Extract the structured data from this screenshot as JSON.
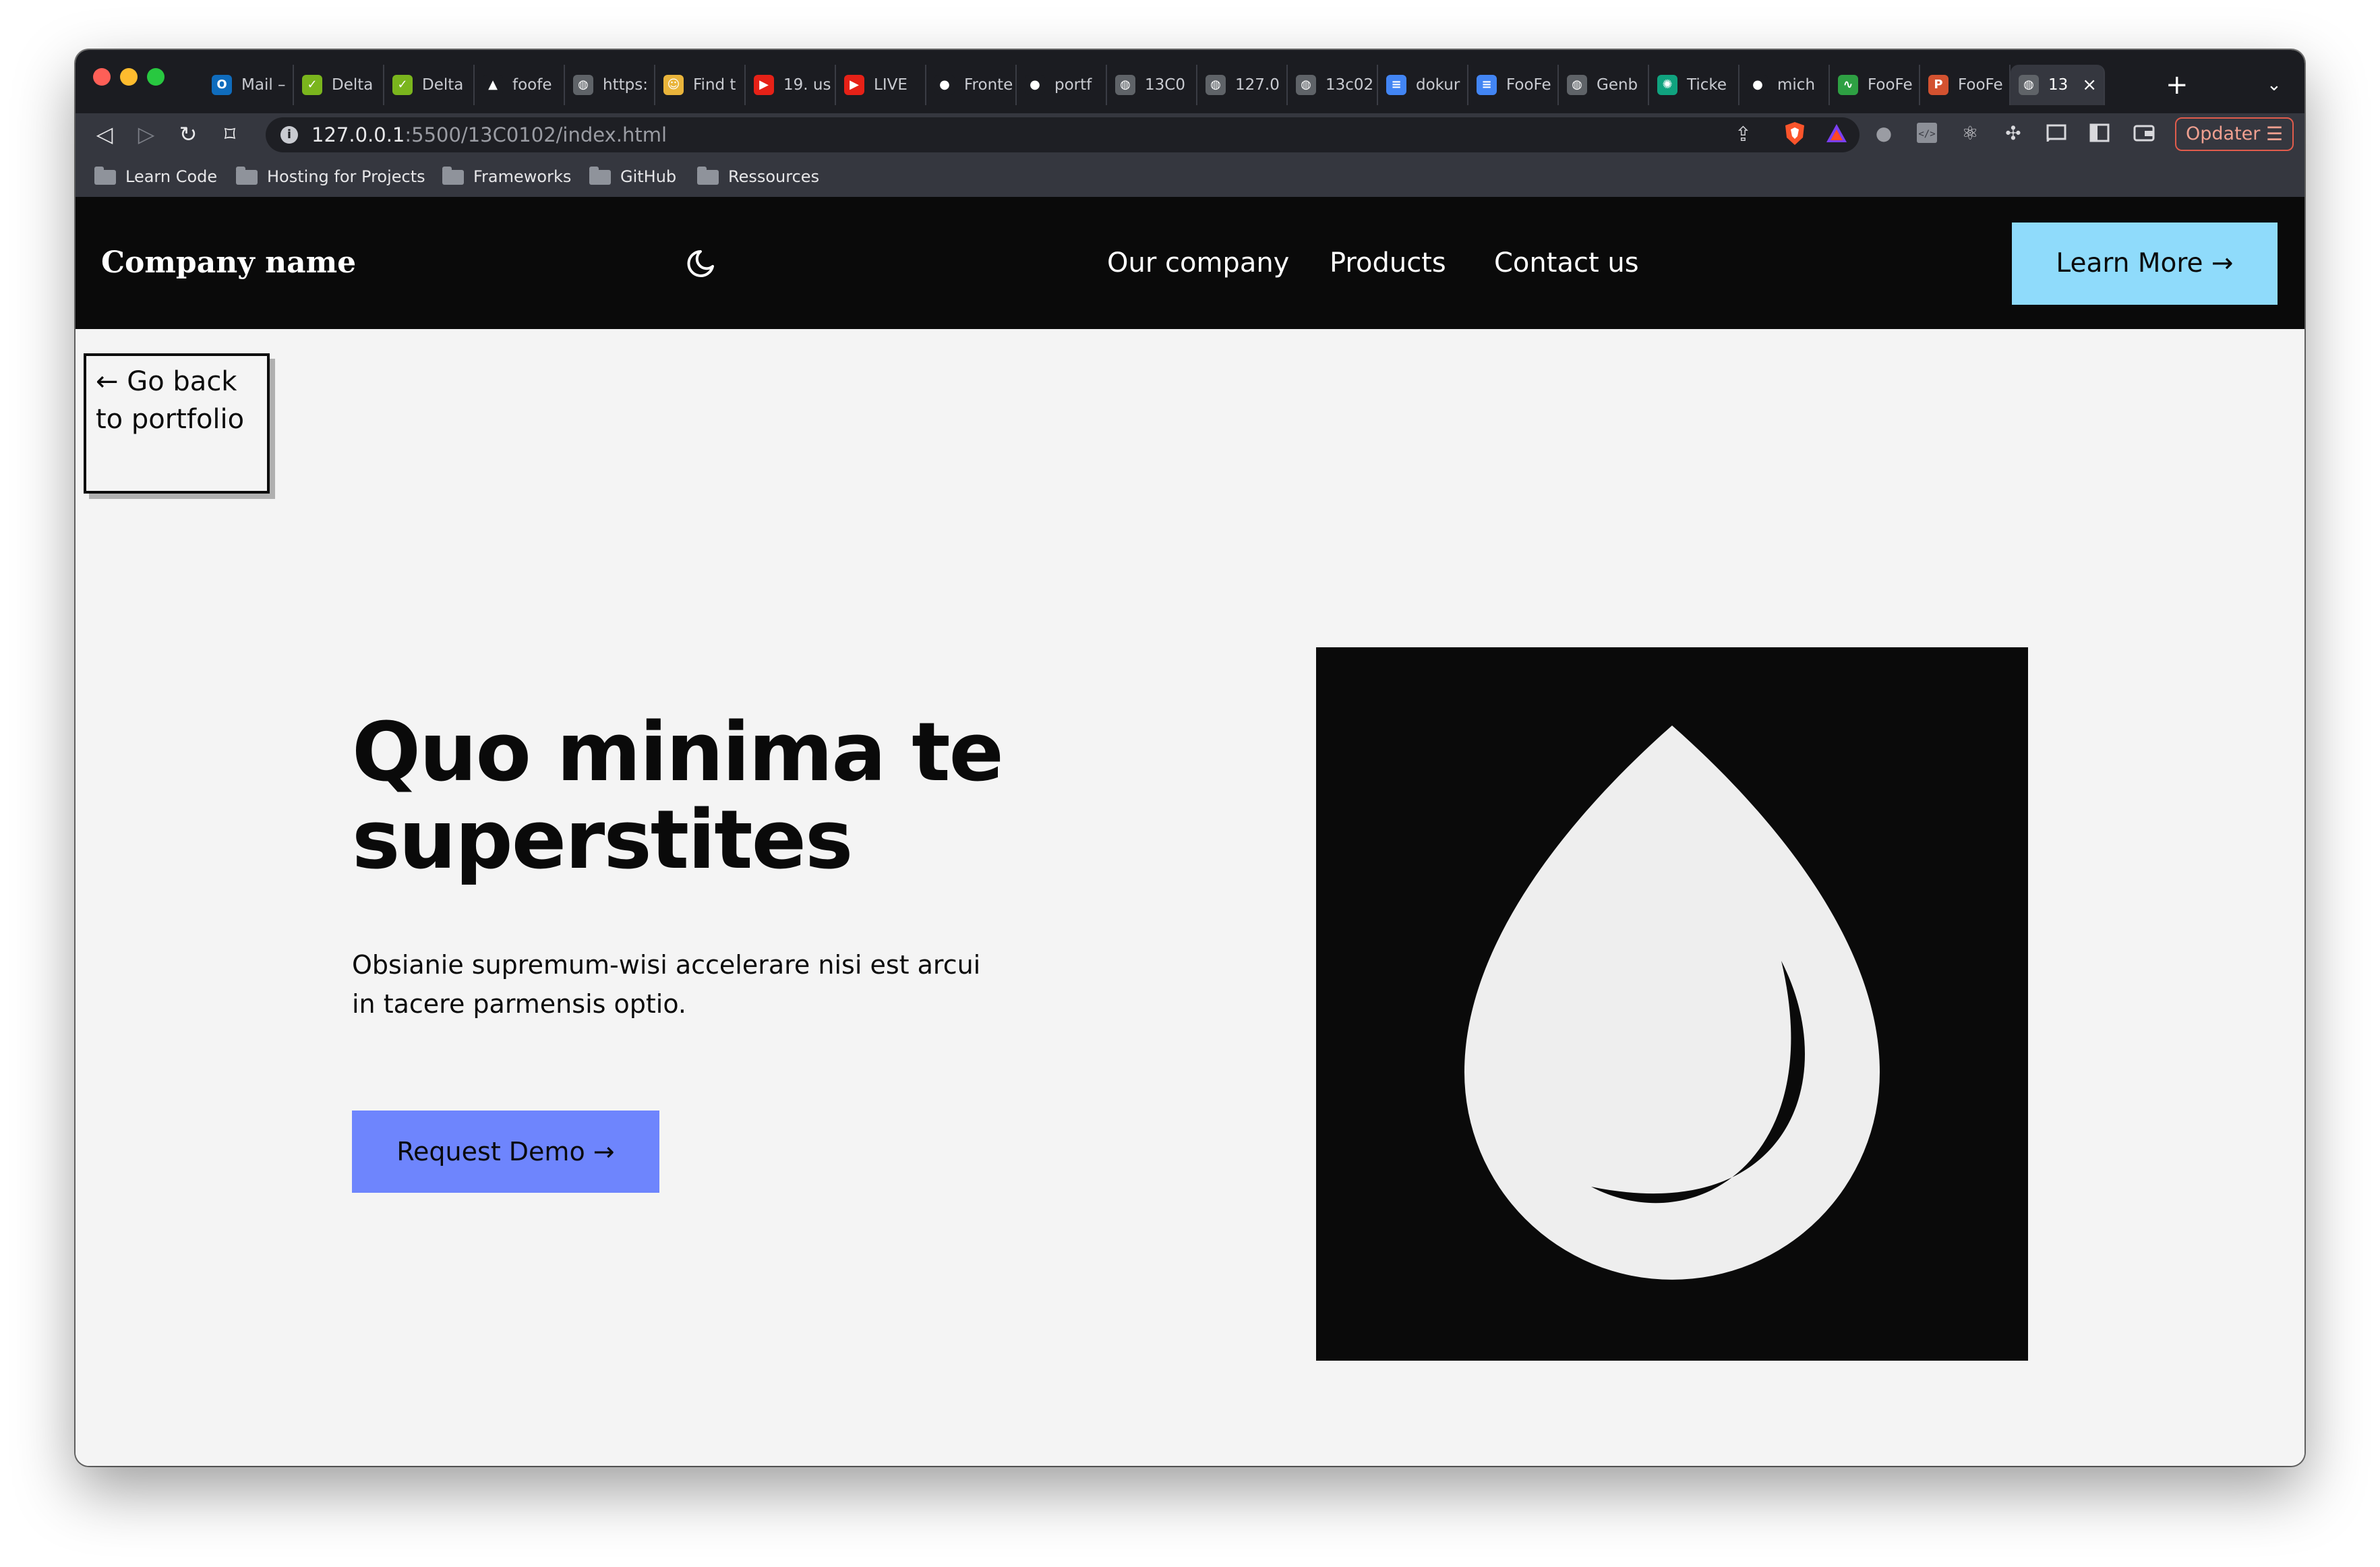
{
  "browser": {
    "tabs": [
      {
        "label": "Mail –",
        "icon": "outlook-icon",
        "color": "#0f6cbd"
      },
      {
        "label": "Delta",
        "icon": "delta-icon",
        "color": "#7ab51d"
      },
      {
        "label": "Delta",
        "icon": "delta-icon",
        "color": "#7ab51d"
      },
      {
        "label": "foofe",
        "icon": "triangle-icon",
        "color": "#1b1c21"
      },
      {
        "label": "https:",
        "icon": "globe-icon",
        "color": "#5f6368"
      },
      {
        "label": "Find t",
        "icon": "smile-icon",
        "color": "#e9b43b"
      },
      {
        "label": "19. us",
        "icon": "youtube-icon",
        "color": "#e62117"
      },
      {
        "label": "LIVE",
        "icon": "youtube-icon",
        "color": "#e62117"
      },
      {
        "label": "Fronte",
        "icon": "github-icon",
        "color": "#1b1c21"
      },
      {
        "label": "portf",
        "icon": "github-icon",
        "color": "#1b1c21"
      },
      {
        "label": "13C0",
        "icon": "globe-icon",
        "color": "#5f6368"
      },
      {
        "label": "127.0",
        "icon": "globe-icon",
        "color": "#5f6368"
      },
      {
        "label": "13c02",
        "icon": "globe-icon",
        "color": "#5f6368"
      },
      {
        "label": "dokur",
        "icon": "docs-icon",
        "color": "#4285f4"
      },
      {
        "label": "FooFe",
        "icon": "docs-icon",
        "color": "#4285f4"
      },
      {
        "label": "Genb",
        "icon": "globe-icon",
        "color": "#5f6368"
      },
      {
        "label": "Ticke",
        "icon": "openai-icon",
        "color": "#10a37f"
      },
      {
        "label": "mich",
        "icon": "github-icon",
        "color": "#1b1c21"
      },
      {
        "label": "FooFe",
        "icon": "activity-icon",
        "color": "#2ea043"
      },
      {
        "label": "FooFe",
        "icon": "powerpoint-icon",
        "color": "#d35230"
      },
      {
        "label": "13",
        "icon": "globe-icon",
        "color": "#5f6368",
        "active": true
      }
    ],
    "url_host": "127.0.0.1",
    "url_path": ":5500/13C0102/index.html",
    "update_button": "Opdater",
    "bookmarks": [
      "Learn Code",
      "Hosting for Projects",
      "Frameworks",
      "GitHub",
      "Ressources"
    ]
  },
  "site": {
    "brand": "Company name",
    "nav": [
      "Our company",
      "Products",
      "Contact us"
    ],
    "cta": "Learn More →",
    "back_link": "← Go back to portfolio",
    "hero": {
      "title": "Quo minima te superstites",
      "text": "Obsianie supremum-wisi accelerare nisi est arcui in tacere parmensis optio.",
      "button": "Request Demo →"
    },
    "colors": {
      "navbar_bg": "#0a0a0a",
      "page_bg": "#f4f4f4",
      "learn_more_bg": "#8fdbfb",
      "request_demo_bg": "#6e85fd",
      "logo_drop": "#eeeeee"
    },
    "logo_icon": "water-drop-icon"
  }
}
